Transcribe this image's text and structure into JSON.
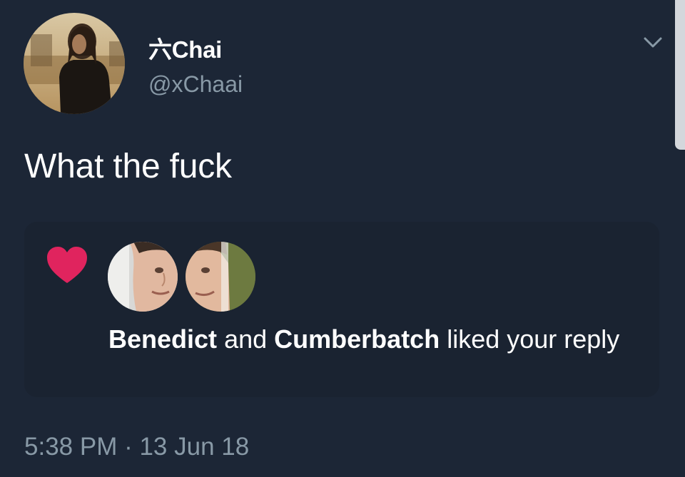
{
  "tweet": {
    "author": {
      "display_name": "六Chai",
      "handle": "@xChaai",
      "avatar": "profile-photo"
    },
    "menu_icon": "chevron-down-icon",
    "text": "What the fuck",
    "timestamp": "5:38 PM · 13 Jun 18"
  },
  "notification": {
    "icon": "heart-icon",
    "icon_color": "#e0245e",
    "liker_1": "Benedict",
    "connector": "and",
    "liker_2": "Cumberbatch",
    "message_rest": "liked your reply"
  },
  "colors": {
    "background": "#1c2636",
    "card": "#1a2331",
    "secondary_text": "#8899a6"
  }
}
